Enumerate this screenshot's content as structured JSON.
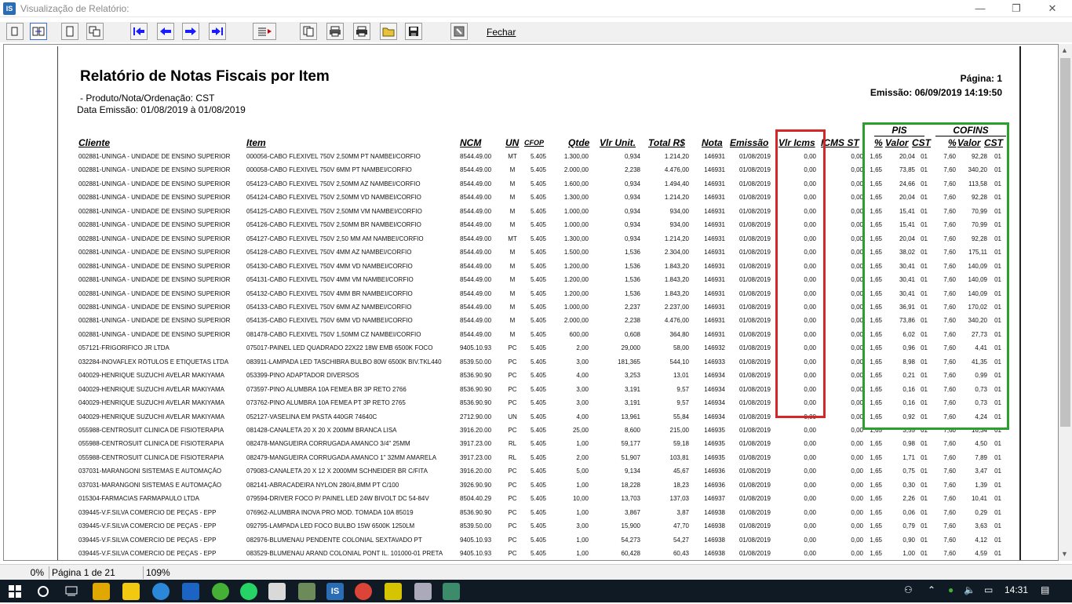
{
  "window": {
    "title": "Visualização de Relatório:",
    "app_icon_text": "IS",
    "minimize": "—",
    "maximize": "❐",
    "close": "✕"
  },
  "toolbar": {
    "buttons": [
      {
        "name": "one-page-button",
        "icon": "page-icon"
      },
      {
        "name": "two-pages-button",
        "icon": "two-pages-icon"
      },
      {
        "name": "page-width-button",
        "icon": "page-width-icon"
      },
      {
        "name": "multi-page-button",
        "icon": "multi-page-icon"
      },
      {
        "name": "first-page-button",
        "icon": "first-page-icon"
      },
      {
        "name": "prev-page-button",
        "icon": "prev-page-icon"
      },
      {
        "name": "next-page-button",
        "icon": "next-page-icon"
      },
      {
        "name": "last-page-button",
        "icon": "last-page-icon"
      },
      {
        "name": "goto-page-button",
        "icon": "goto-page-icon"
      },
      {
        "name": "copy-button",
        "icon": "copy-icon"
      },
      {
        "name": "print-setup-button",
        "icon": "printer-setup-icon"
      },
      {
        "name": "print-button",
        "icon": "printer-icon"
      },
      {
        "name": "open-button",
        "icon": "folder-icon"
      },
      {
        "name": "save-button",
        "icon": "floppy-icon"
      },
      {
        "name": "export-button",
        "icon": "export-icon"
      }
    ],
    "close_label": "Fechar"
  },
  "report": {
    "title": "Relatório de Notas Fiscais por Item",
    "subtitle": "- Produto/Nota/Ordenação: CST",
    "period": "Data Emissão: 01/08/2019 à 01/08/2019",
    "page_label": "Página: 1",
    "emission_label": "Emissão: 06/09/2019 14:19:50",
    "group_pis": "PIS",
    "group_cofins": "COFINS",
    "columns": {
      "cliente": "Cliente",
      "item": "Item",
      "ncm": "NCM",
      "un": "UN",
      "cfop": "CFOP",
      "qtde": "Qtde",
      "vunit": "Vlr Unit.",
      "total": "Total R$",
      "nota": "Nota",
      "emissao": "Emissão",
      "vicms": "Vlr Icms",
      "icmsst": "ICMS ST",
      "pis_pct": "%",
      "pis_valor": "Valor",
      "pis_cst": "CST",
      "cof_pct": "%",
      "cof_valor": "Valor",
      "cof_cst": "CST"
    },
    "rows": [
      [
        "002881-UNINGA - UNIDADE DE ENSINO SUPERIOR",
        "000056-CABO FLEXIVEL 750V 2,50MM PT NAMBEI/CORFIO",
        "8544.49.00",
        "MT",
        "5.405",
        "1.300,00",
        "0,934",
        "1.214,20",
        "146931",
        "01/08/2019",
        "0,00",
        "0,00",
        "1,65",
        "20,04",
        "01",
        "7,60",
        "92,28",
        "01"
      ],
      [
        "002881-UNINGA - UNIDADE DE ENSINO SUPERIOR",
        "000058-CABO FLEXIVEL 750V 6MM PT NAMBEI/CORFIO",
        "8544.49.00",
        "M",
        "5.405",
        "2.000,00",
        "2,238",
        "4.476,00",
        "146931",
        "01/08/2019",
        "0,00",
        "0,00",
        "1,65",
        "73,85",
        "01",
        "7,60",
        "340,20",
        "01"
      ],
      [
        "002881-UNINGA - UNIDADE DE ENSINO SUPERIOR",
        "054123-CABO FLEXIVEL 750V 2,50MM AZ NAMBEI/CORFIO",
        "8544.49.00",
        "M",
        "5.405",
        "1.600,00",
        "0,934",
        "1.494,40",
        "146931",
        "01/08/2019",
        "0,00",
        "0,00",
        "1,65",
        "24,66",
        "01",
        "7,60",
        "113,58",
        "01"
      ],
      [
        "002881-UNINGA - UNIDADE DE ENSINO SUPERIOR",
        "054124-CABO FLEXIVEL 750V 2,50MM VD NAMBEI/CORFIO",
        "8544.49.00",
        "M",
        "5.405",
        "1.300,00",
        "0,934",
        "1.214,20",
        "146931",
        "01/08/2019",
        "0,00",
        "0,00",
        "1,65",
        "20,04",
        "01",
        "7,60",
        "92,28",
        "01"
      ],
      [
        "002881-UNINGA - UNIDADE DE ENSINO SUPERIOR",
        "054125-CABO FLEXIVEL 750V 2,50MM VM NAMBEI/CORFIO",
        "8544.49.00",
        "M",
        "5.405",
        "1.000,00",
        "0,934",
        "934,00",
        "146931",
        "01/08/2019",
        "0,00",
        "0,00",
        "1,65",
        "15,41",
        "01",
        "7,60",
        "70,99",
        "01"
      ],
      [
        "002881-UNINGA - UNIDADE DE ENSINO SUPERIOR",
        "054126-CABO FLEXIVEL 750V 2,50MM BR NAMBEI/CORFIO",
        "8544.49.00",
        "M",
        "5.405",
        "1.000,00",
        "0,934",
        "934,00",
        "146931",
        "01/08/2019",
        "0,00",
        "0,00",
        "1,65",
        "15,41",
        "01",
        "7,60",
        "70,99",
        "01"
      ],
      [
        "002881-UNINGA - UNIDADE DE ENSINO SUPERIOR",
        "054127-CABO FLEXIVEL 750V 2,50 MM AM NAMBEI/CORFIO",
        "8544.49.00",
        "MT",
        "5.405",
        "1.300,00",
        "0,934",
        "1.214,20",
        "146931",
        "01/08/2019",
        "0,00",
        "0,00",
        "1,65",
        "20,04",
        "01",
        "7,60",
        "92,28",
        "01"
      ],
      [
        "002881-UNINGA - UNIDADE DE ENSINO SUPERIOR",
        "054128-CABO FLEXIVEL 750V 4MM AZ NAMBEI/CORFIO",
        "8544.49.00",
        "M",
        "5.405",
        "1.500,00",
        "1,536",
        "2.304,00",
        "146931",
        "01/08/2019",
        "0,00",
        "0,00",
        "1,65",
        "38,02",
        "01",
        "7,60",
        "175,11",
        "01"
      ],
      [
        "002881-UNINGA - UNIDADE DE ENSINO SUPERIOR",
        "054130-CABO FLEXIVEL 750V 4MM VD NAMBEI/CORFIO",
        "8544.49.00",
        "M",
        "5.405",
        "1.200,00",
        "1,536",
        "1.843,20",
        "146931",
        "01/08/2019",
        "0,00",
        "0,00",
        "1,65",
        "30,41",
        "01",
        "7,60",
        "140,09",
        "01"
      ],
      [
        "002881-UNINGA - UNIDADE DE ENSINO SUPERIOR",
        "054131-CABO FLEXIVEL 750V 4MM VM NAMBEI/CORFIO",
        "8544.49.00",
        "M",
        "5.405",
        "1.200,00",
        "1,536",
        "1.843,20",
        "146931",
        "01/08/2019",
        "0,00",
        "0,00",
        "1,65",
        "30,41",
        "01",
        "7,60",
        "140,09",
        "01"
      ],
      [
        "002881-UNINGA - UNIDADE DE ENSINO SUPERIOR",
        "054132-CABO FLEXIVEL 750V 4MM BR NAMBEI/CORFIO",
        "8544.49.00",
        "M",
        "5.405",
        "1.200,00",
        "1,536",
        "1.843,20",
        "146931",
        "01/08/2019",
        "0,00",
        "0,00",
        "1,65",
        "30,41",
        "01",
        "7,60",
        "140,09",
        "01"
      ],
      [
        "002881-UNINGA - UNIDADE DE ENSINO SUPERIOR",
        "054133-CABO FLEXIVEL 750V 6MM AZ NAMBEI/CORFIO",
        "8544.49.00",
        "M",
        "5.405",
        "1.000,00",
        "2,237",
        "2.237,00",
        "146931",
        "01/08/2019",
        "0,00",
        "0,00",
        "1,65",
        "36,91",
        "01",
        "7,60",
        "170,02",
        "01"
      ],
      [
        "002881-UNINGA - UNIDADE DE ENSINO SUPERIOR",
        "054135-CABO FLEXIVEL 750V 6MM VD NAMBEI/CORFIO",
        "8544.49.00",
        "M",
        "5.405",
        "2.000,00",
        "2,238",
        "4.476,00",
        "146931",
        "01/08/2019",
        "0,00",
        "0,00",
        "1,65",
        "73,86",
        "01",
        "7,60",
        "340,20",
        "01"
      ],
      [
        "002881-UNINGA - UNIDADE DE ENSINO SUPERIOR",
        "081478-CABO FLEXIVEL 750V 1,50MM CZ NAMBEI/CORFIO",
        "8544.49.00",
        "M",
        "5.405",
        "600,00",
        "0,608",
        "364,80",
        "146931",
        "01/08/2019",
        "0,00",
        "0,00",
        "1,65",
        "6,02",
        "01",
        "7,60",
        "27,73",
        "01"
      ],
      [
        "057121-FRIGORIFICO JR LTDA",
        "075017-PAINEL LED QUADRADO 22X22 18W EMB 6500K FOCO",
        "9405.10.93",
        "PC",
        "5.405",
        "2,00",
        "29,000",
        "58,00",
        "146932",
        "01/08/2019",
        "0,00",
        "0,00",
        "1,65",
        "0,96",
        "01",
        "7,60",
        "4,41",
        "01"
      ],
      [
        "032284-INOVAFLEX RÓTULOS E ETIQUETAS LTDA",
        "083911-LAMPADA LED TASCHIBRA BULBO 80W 6500K BIV.TKL440",
        "8539.50.00",
        "PC",
        "5.405",
        "3,00",
        "181,365",
        "544,10",
        "146933",
        "01/08/2019",
        "0,00",
        "0,00",
        "1,65",
        "8,98",
        "01",
        "7,60",
        "41,35",
        "01"
      ],
      [
        "040029-HENRIQUE SUZUCHI AVELAR MAKIYAMA",
        "053399-PINO ADAPTADOR DIVERSOS",
        "8536.90.90",
        "PC",
        "5.405",
        "4,00",
        "3,253",
        "13,01",
        "146934",
        "01/08/2019",
        "0,00",
        "0,00",
        "1,65",
        "0,21",
        "01",
        "7,60",
        "0,99",
        "01"
      ],
      [
        "040029-HENRIQUE SUZUCHI AVELAR MAKIYAMA",
        "073597-PINO ALUMBRA 10A FEMEA BR 3P RETO  2766",
        "8536.90.90",
        "PC",
        "5.405",
        "3,00",
        "3,191",
        "9,57",
        "146934",
        "01/08/2019",
        "0,00",
        "0,00",
        "1,65",
        "0,16",
        "01",
        "7,60",
        "0,73",
        "01"
      ],
      [
        "040029-HENRIQUE SUZUCHI AVELAR MAKIYAMA",
        "073762-PINO ALUMBRA 10A FEMEA PT 3P RETO  2765",
        "8536.90.90",
        "PC",
        "5.405",
        "3,00",
        "3,191",
        "9,57",
        "146934",
        "01/08/2019",
        "0,00",
        "0,00",
        "1,65",
        "0,16",
        "01",
        "7,60",
        "0,73",
        "01"
      ],
      [
        "040029-HENRIQUE SUZUCHI AVELAR MAKIYAMA",
        "052127-VASELINA EM PASTA 440GR  74640C",
        "2712.90.00",
        "UN",
        "5.405",
        "4,00",
        "13,961",
        "55,84",
        "146934",
        "01/08/2019",
        "0,00",
        "0,00",
        "1,65",
        "0,92",
        "01",
        "7,60",
        "4,24",
        "01"
      ],
      [
        "055988-CENTROSUIT CLINICA DE FISIOTERAPIA",
        "081428-CANALETA 20 X 20 X 200MM BRANCA  LISA",
        "3916.20.00",
        "PC",
        "5.405",
        "25,00",
        "8,600",
        "215,00",
        "146935",
        "01/08/2019",
        "0,00",
        "0,00",
        "1,65",
        "3,55",
        "01",
        "7,60",
        "16,34",
        "01"
      ],
      [
        "055988-CENTROSUIT CLINICA DE FISIOTERAPIA",
        "082478-MANGUEIRA CORRUGADA AMANCO  3/4\" 25MM",
        "3917.23.00",
        "RL",
        "5.405",
        "1,00",
        "59,177",
        "59,18",
        "146935",
        "01/08/2019",
        "0,00",
        "0,00",
        "1,65",
        "0,98",
        "01",
        "7,60",
        "4,50",
        "01"
      ],
      [
        "055988-CENTROSUIT CLINICA DE FISIOTERAPIA",
        "082479-MANGUEIRA CORRUGADA AMANCO  1\" 32MM AMARELA",
        "3917.23.00",
        "RL",
        "5.405",
        "2,00",
        "51,907",
        "103,81",
        "146935",
        "01/08/2019",
        "0,00",
        "0,00",
        "1,65",
        "1,71",
        "01",
        "7,60",
        "7,89",
        "01"
      ],
      [
        "037031-MARANGONI SISTEMAS E AUTOMAÇÃO",
        "079083-CANALETA 20 X 12 X 2000MM SCHNEIDER BR C/FITA",
        "3916.20.00",
        "PC",
        "5.405",
        "5,00",
        "9,134",
        "45,67",
        "146936",
        "01/08/2019",
        "0,00",
        "0,00",
        "1,65",
        "0,75",
        "01",
        "7,60",
        "3,47",
        "01"
      ],
      [
        "037031-MARANGONI SISTEMAS E AUTOMAÇÃO",
        "082141-ABRACADEIRA NYLON 280/4,8MM PT C/100",
        "3926.90.90",
        "PC",
        "5.405",
        "1,00",
        "18,228",
        "18,23",
        "146936",
        "01/08/2019",
        "0,00",
        "0,00",
        "1,65",
        "0,30",
        "01",
        "7,60",
        "1,39",
        "01"
      ],
      [
        "015304-FARMACIAS FARMAPAULO LTDA",
        "079594-DRIVER FOCO P/ PAINEL LED 24W BIVOLT DC 54-84V",
        "8504.40.29",
        "PC",
        "5.405",
        "10,00",
        "13,703",
        "137,03",
        "146937",
        "01/08/2019",
        "0,00",
        "0,00",
        "1,65",
        "2,26",
        "01",
        "7,60",
        "10,41",
        "01"
      ],
      [
        "039445-V.F.SILVA COMERCIO DE PEÇAS - EPP",
        "076962-ALUMBRA INOVA PRO MOD. TOMADA 10A  85019",
        "8536.90.90",
        "PC",
        "5.405",
        "1,00",
        "3,867",
        "3,87",
        "146938",
        "01/08/2019",
        "0,00",
        "0,00",
        "1,65",
        "0,06",
        "01",
        "7,60",
        "0,29",
        "01"
      ],
      [
        "039445-V.F.SILVA COMERCIO DE PEÇAS - EPP",
        "092795-LAMPADA LED FOCO BULBO 15W 6500K  1250LM",
        "8539.50.00",
        "PC",
        "5.405",
        "3,00",
        "15,900",
        "47,70",
        "146938",
        "01/08/2019",
        "0,00",
        "0,00",
        "1,65",
        "0,79",
        "01",
        "7,60",
        "3,63",
        "01"
      ],
      [
        "039445-V.F.SILVA COMERCIO DE PEÇAS - EPP",
        "082976-BLUMENAU PENDENTE COLONIAL SEXTAVADO PT",
        "9405.10.93",
        "PC",
        "5.405",
        "1,00",
        "54,273",
        "54,27",
        "146938",
        "01/08/2019",
        "0,00",
        "0,00",
        "1,65",
        "0,90",
        "01",
        "7,60",
        "4,12",
        "01"
      ],
      [
        "039445-V.F.SILVA COMERCIO DE PEÇAS - EPP",
        "083529-BLUMENAU ARAND COLONIAL PONT IL. 101000-01 PRETA",
        "9405.10.93",
        "PC",
        "5.405",
        "1,00",
        "60,428",
        "60,43",
        "146938",
        "01/08/2019",
        "0,00",
        "0,00",
        "1,65",
        "1,00",
        "01",
        "7,60",
        "4,59",
        "01"
      ]
    ]
  },
  "status": {
    "zoom_pct": "0%",
    "page": "Página 1 de 21",
    "scale": "109%"
  },
  "taskbar": {
    "time": "14:31"
  },
  "colors": {
    "highlight_icms": "#d62728",
    "highlight_pis_cofins": "#2ca02c",
    "toolbar_arrow": "#1a1aff"
  }
}
